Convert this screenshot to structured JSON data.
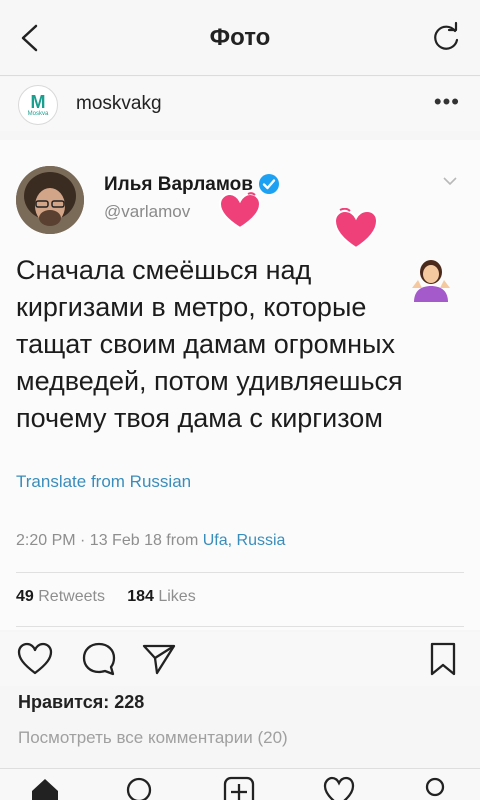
{
  "header": {
    "title": "Фото"
  },
  "post": {
    "account": "moskvakg",
    "logo_letter": "M",
    "logo_sub": "Moskva"
  },
  "tweet": {
    "name": "Илья Варламов",
    "handle": "@varlamov",
    "text_lines": [
      "Сначала смеёшься над",
      "киргизами в метро, которые",
      "тащат своим дамам огромных",
      "медведей, потом удивляешься",
      "почему твоя дама с киргизом"
    ],
    "translate": "Translate from Russian",
    "meta_time": "2:20 PM · 13 Feb 18  from ",
    "meta_location": "Ufa, Russia",
    "retweets_count": "49",
    "retweets_label": "Retweets",
    "likes_count": "184",
    "likes_label": "Likes"
  },
  "engagement": {
    "likes_text": "Нравится: 228",
    "comments_text": "Посмотреть все комментарии (20)"
  },
  "icons": {
    "back": "chevron-left-icon",
    "refresh": "refresh-icon",
    "more": "more-dots-icon",
    "verified": "verified-badge-icon",
    "like": "heart-outline-icon",
    "comment": "comment-bubble-icon",
    "share": "paper-plane-icon",
    "save": "bookmark-icon"
  },
  "colors": {
    "link": "#3a8dbb",
    "verified": "#1da1f2",
    "heart_pink": "#f0407a"
  }
}
